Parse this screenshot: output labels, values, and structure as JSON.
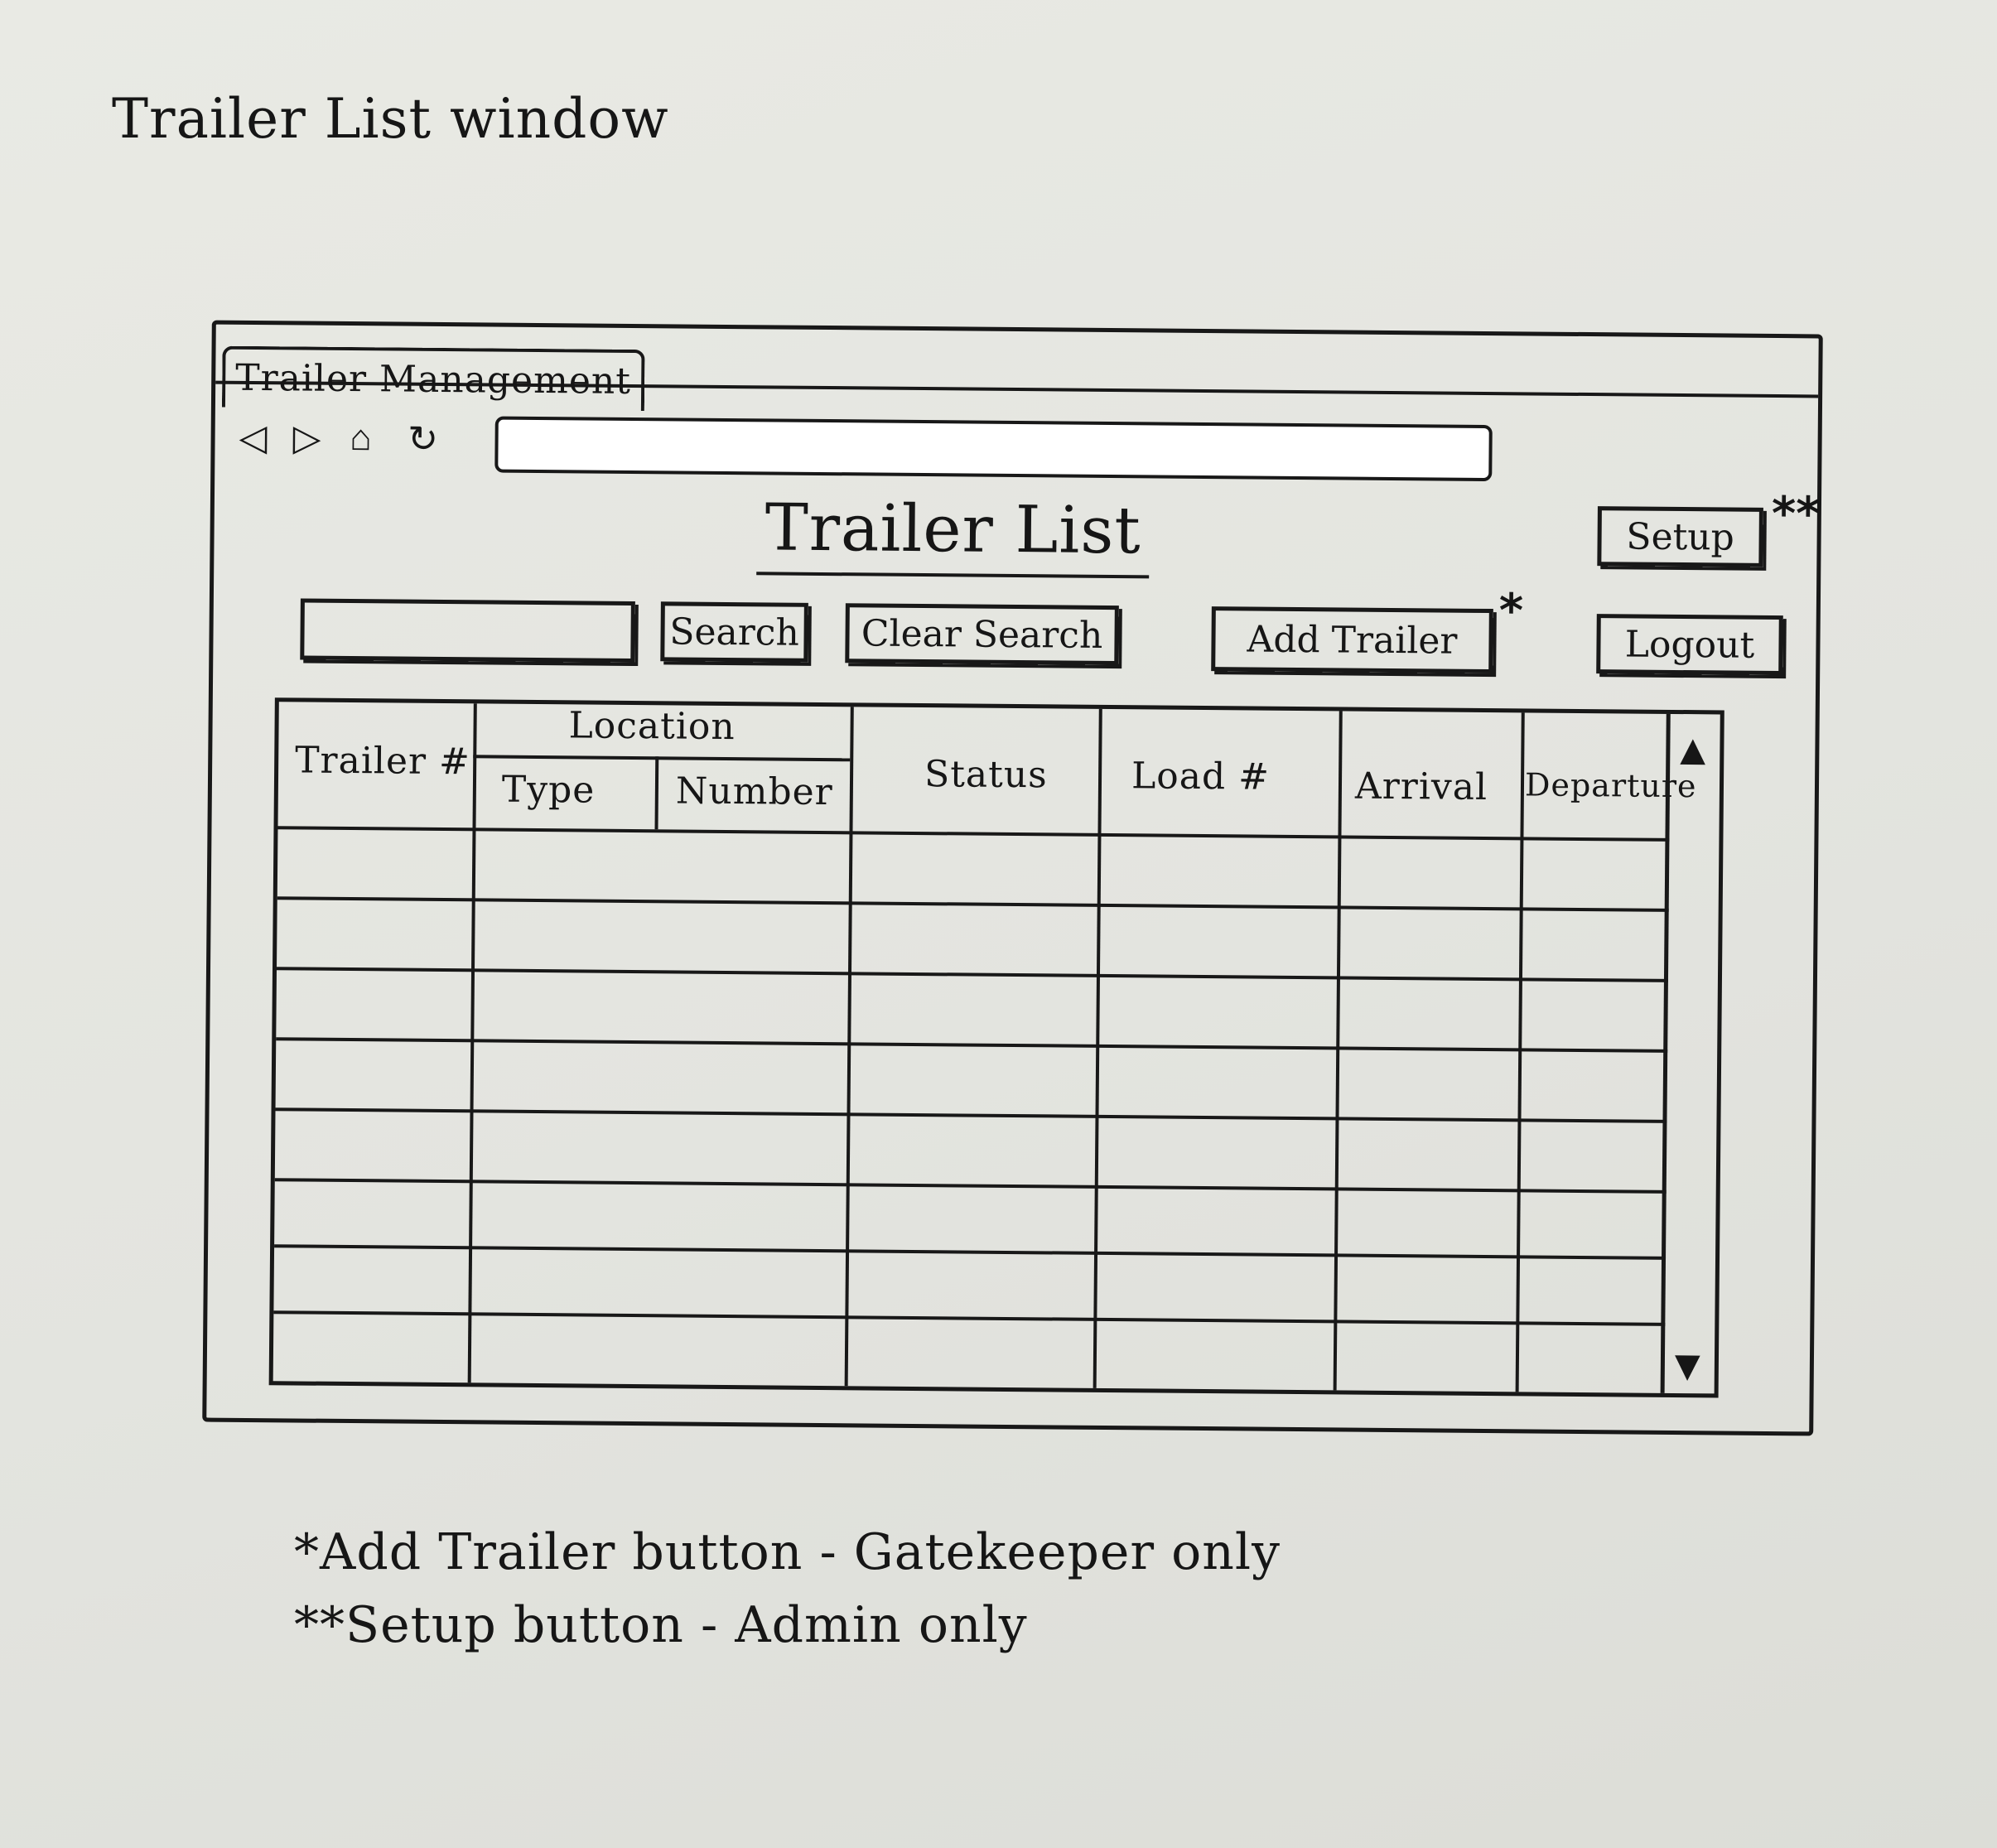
{
  "doc_title": "Trailer List window",
  "window": {
    "tab_label": "Trailer Management",
    "nav": {
      "back": "◁",
      "forward": "▷",
      "home": "⌂",
      "refresh": "↻"
    },
    "address_value": ""
  },
  "page": {
    "title": "Trailer List",
    "setup_label": "Setup",
    "setup_marker": "**",
    "search_value": "",
    "search_label": "Search",
    "clear_search_label": "Clear Search",
    "add_trailer_label": "Add Trailer",
    "add_trailer_marker": "*",
    "logout_label": "Logout"
  },
  "table": {
    "columns": {
      "trailer": "Trailer #",
      "location": "Location",
      "loc_type": "Type",
      "loc_number": "Number",
      "status": "Status",
      "load": "Load #",
      "arrival": "Arrival",
      "departure": "Departure"
    },
    "scroll_up": "▲",
    "scroll_down": "▼"
  },
  "notes": [
    "*Add Trailer button - Gatekeeper only",
    "**Setup button - Admin only"
  ]
}
